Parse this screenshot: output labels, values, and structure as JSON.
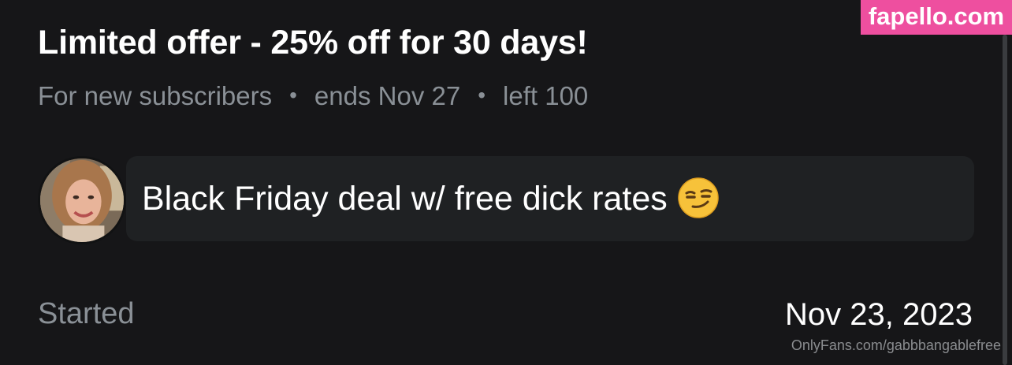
{
  "offer": {
    "title": "Limited offer - 25% off for 30 days!",
    "audience": "For new subscribers",
    "separator": "•",
    "ends": "ends Nov 27",
    "left": "left 100"
  },
  "message": {
    "text": "Black Friday deal w/ free dick rates",
    "emoji_icon": "smirking-face-icon"
  },
  "started": {
    "label": "Started",
    "date": "Nov 23, 2023"
  },
  "watermark": {
    "text": "fapello.com",
    "color": "#ee4f9f"
  },
  "credit": {
    "text": "OnlyFans.com/gabbbangablefree"
  },
  "colors": {
    "background": "#161618",
    "muted_text": "#8a9096",
    "message_bg": "#1f2123"
  }
}
